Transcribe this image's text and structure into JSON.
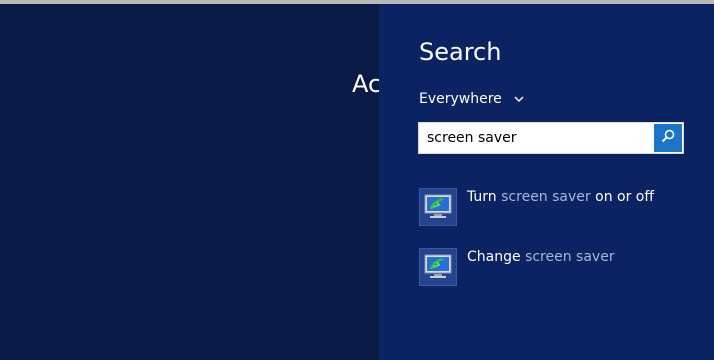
{
  "background": {
    "partial_heading": "Ac"
  },
  "search_panel": {
    "title": "Search",
    "scope": {
      "label": "Everywhere"
    },
    "search": {
      "value": "screen saver"
    },
    "results": [
      {
        "prefix": "Turn ",
        "highlight": "screen saver",
        "suffix": " on or off",
        "icon": "monitor-screensaver-icon"
      },
      {
        "prefix": "Change ",
        "highlight": "screen saver",
        "suffix": "",
        "icon": "monitor-screensaver-icon"
      }
    ]
  },
  "colors": {
    "background": "#0a1a47",
    "panel": "#0b2362",
    "search_button": "#1b74c7",
    "dim_text": "#a7b6d6"
  }
}
